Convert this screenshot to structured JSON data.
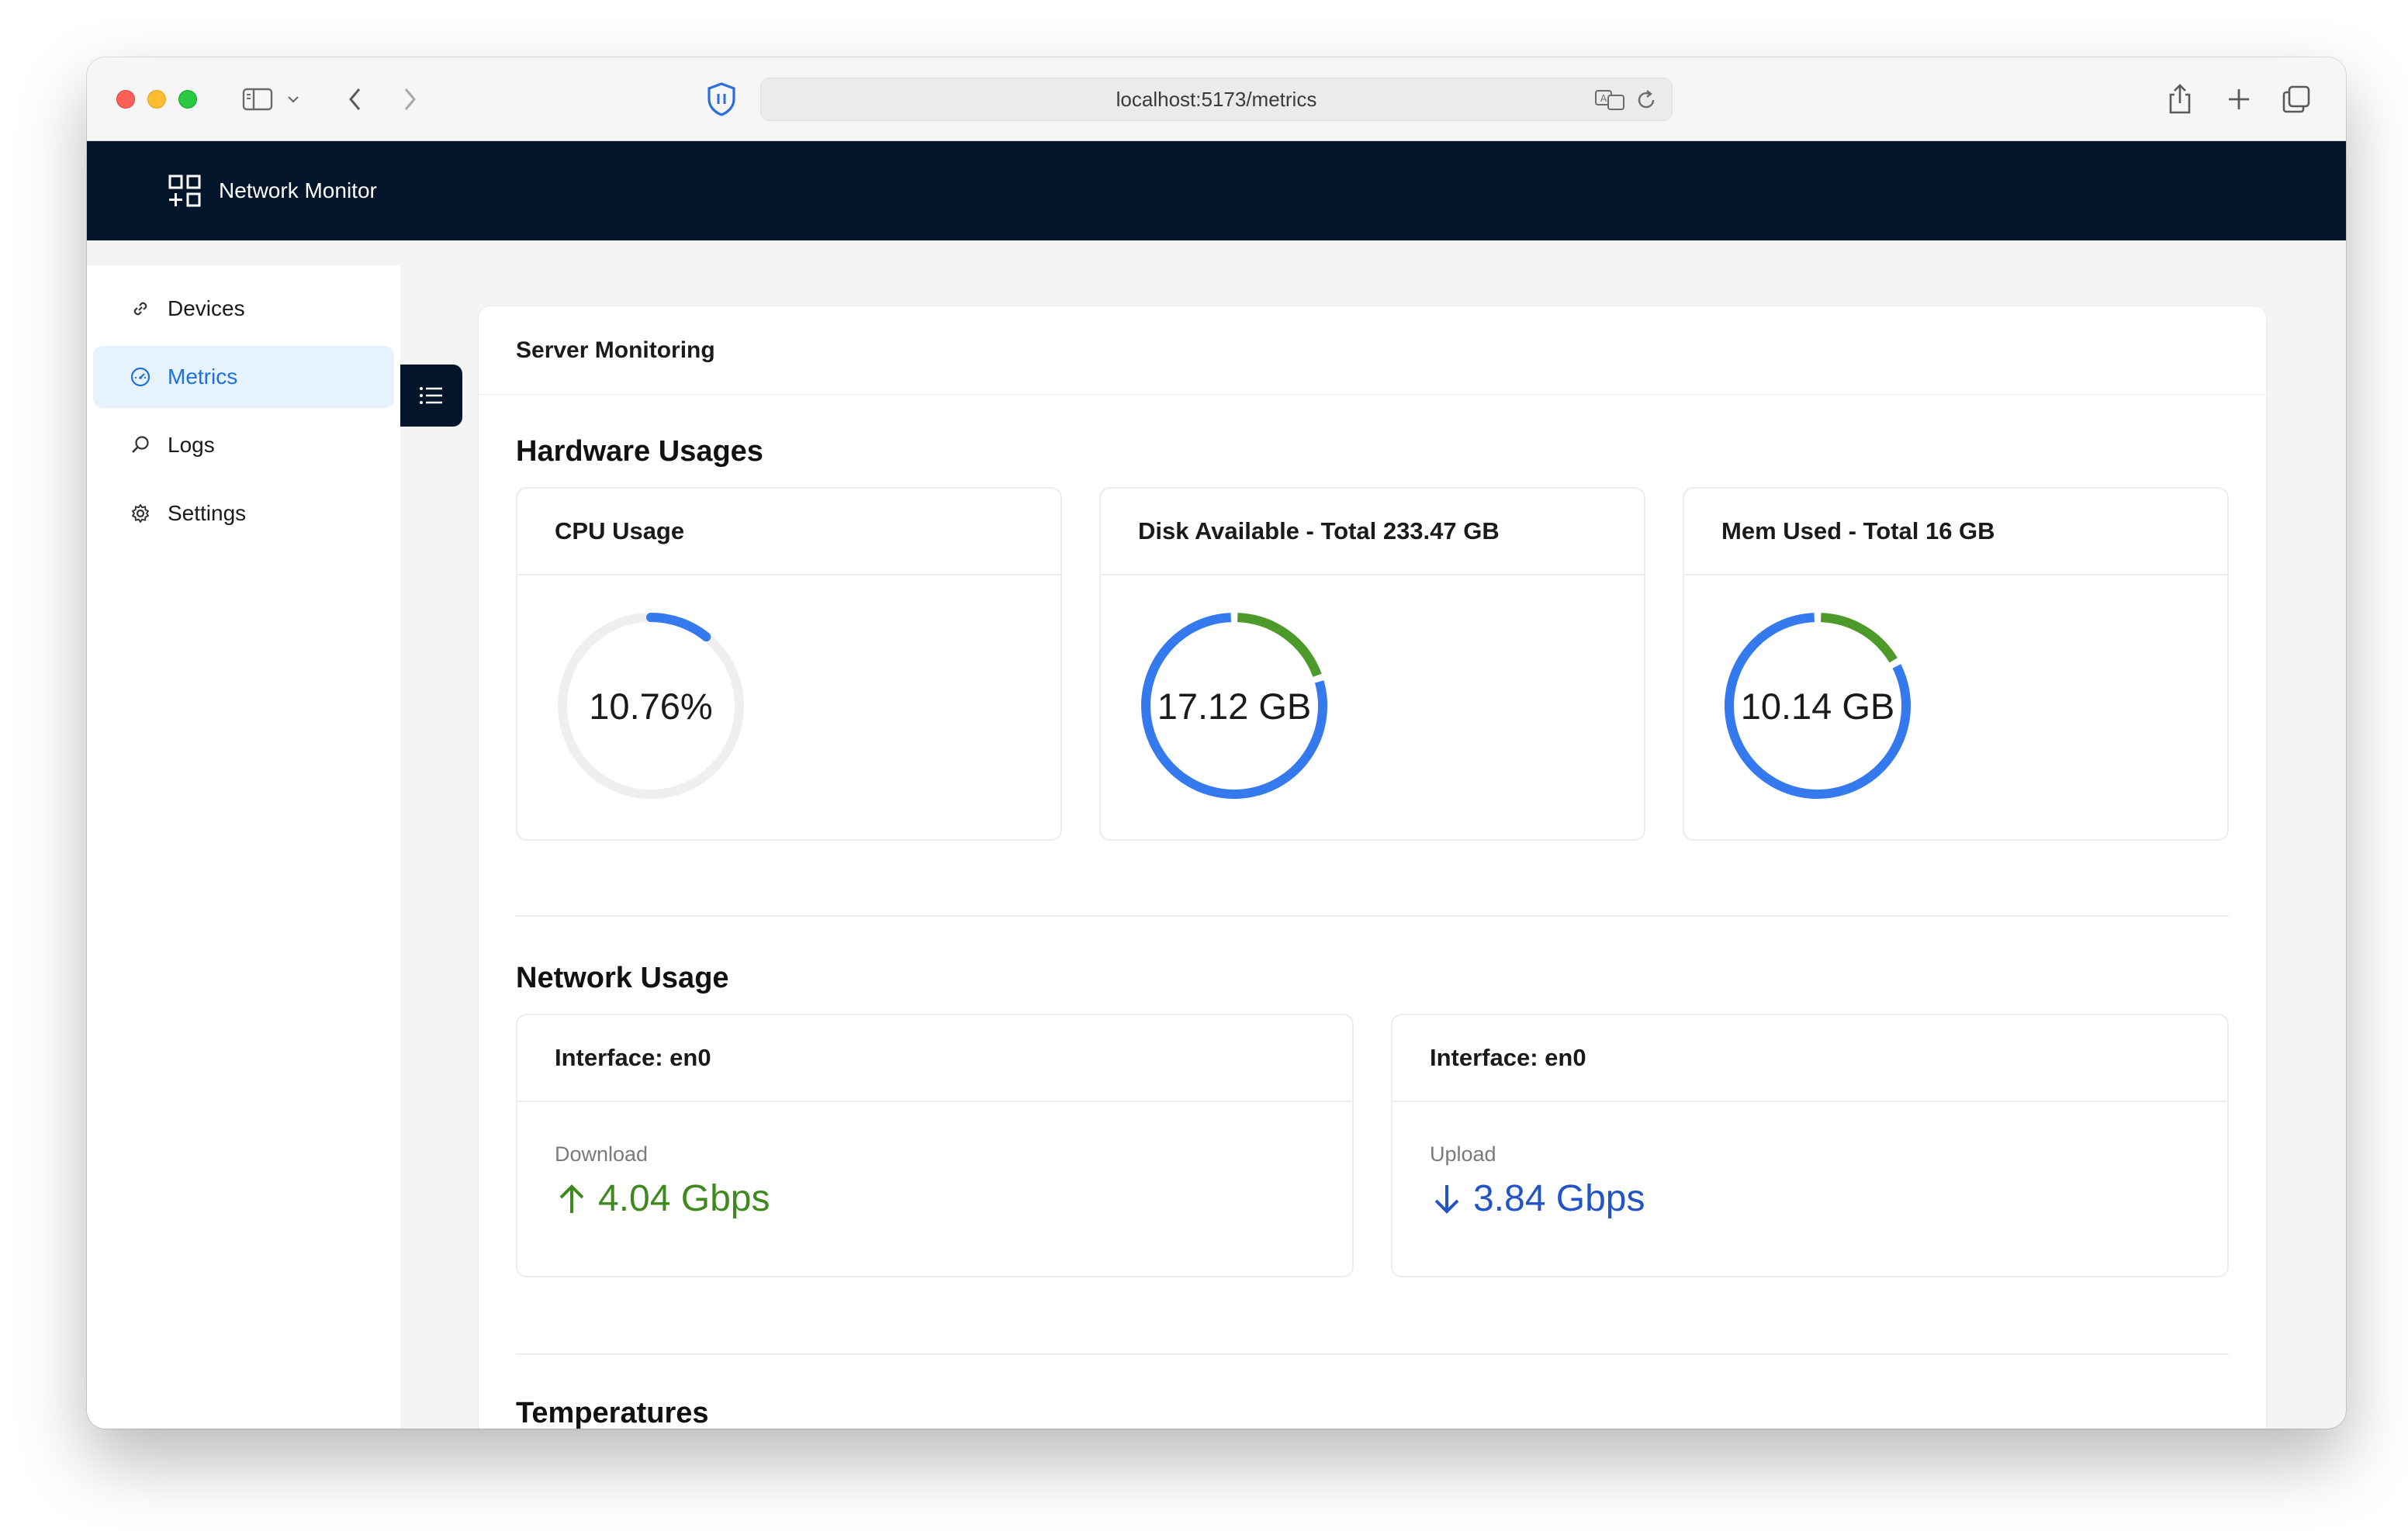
{
  "browser": {
    "url": "localhost:5173/metrics"
  },
  "app": {
    "brand": "Network Monitor"
  },
  "sidebar": {
    "items": [
      {
        "label": "Devices",
        "icon": "link-icon"
      },
      {
        "label": "Metrics",
        "icon": "dashboard-icon",
        "active": true
      },
      {
        "label": "Logs",
        "icon": "search-icon"
      },
      {
        "label": "Settings",
        "icon": "gear-icon"
      }
    ]
  },
  "page": {
    "title": "Server Monitoring"
  },
  "hardware": {
    "section_title": "Hardware Usages",
    "cards": [
      {
        "title": "CPU Usage",
        "value": "10.76%",
        "percent": 10.76
      },
      {
        "title": "Disk Available - Total 233.47 GB",
        "value": "17.12 GB",
        "used_fraction": 0.8
      },
      {
        "title": "Mem Used - Total 16 GB",
        "value": "10.14 GB",
        "used_fraction": 0.83
      }
    ]
  },
  "network": {
    "section_title": "Network Usage",
    "cards": [
      {
        "title": "Interface: en0",
        "label": "Download",
        "value": "4.04 Gbps",
        "direction": "up"
      },
      {
        "title": "Interface: en0",
        "label": "Upload",
        "value": "3.84 Gbps",
        "direction": "down"
      }
    ]
  },
  "temperatures": {
    "section_title": "Temperatures"
  },
  "colors": {
    "header_bg": "#03152b",
    "accent_blue": "#3479ee",
    "accent_green": "#4c9a2a",
    "active_nav_bg": "#e6f2fd",
    "download_green": "#3f8a1e",
    "upload_blue": "#2354c6"
  }
}
